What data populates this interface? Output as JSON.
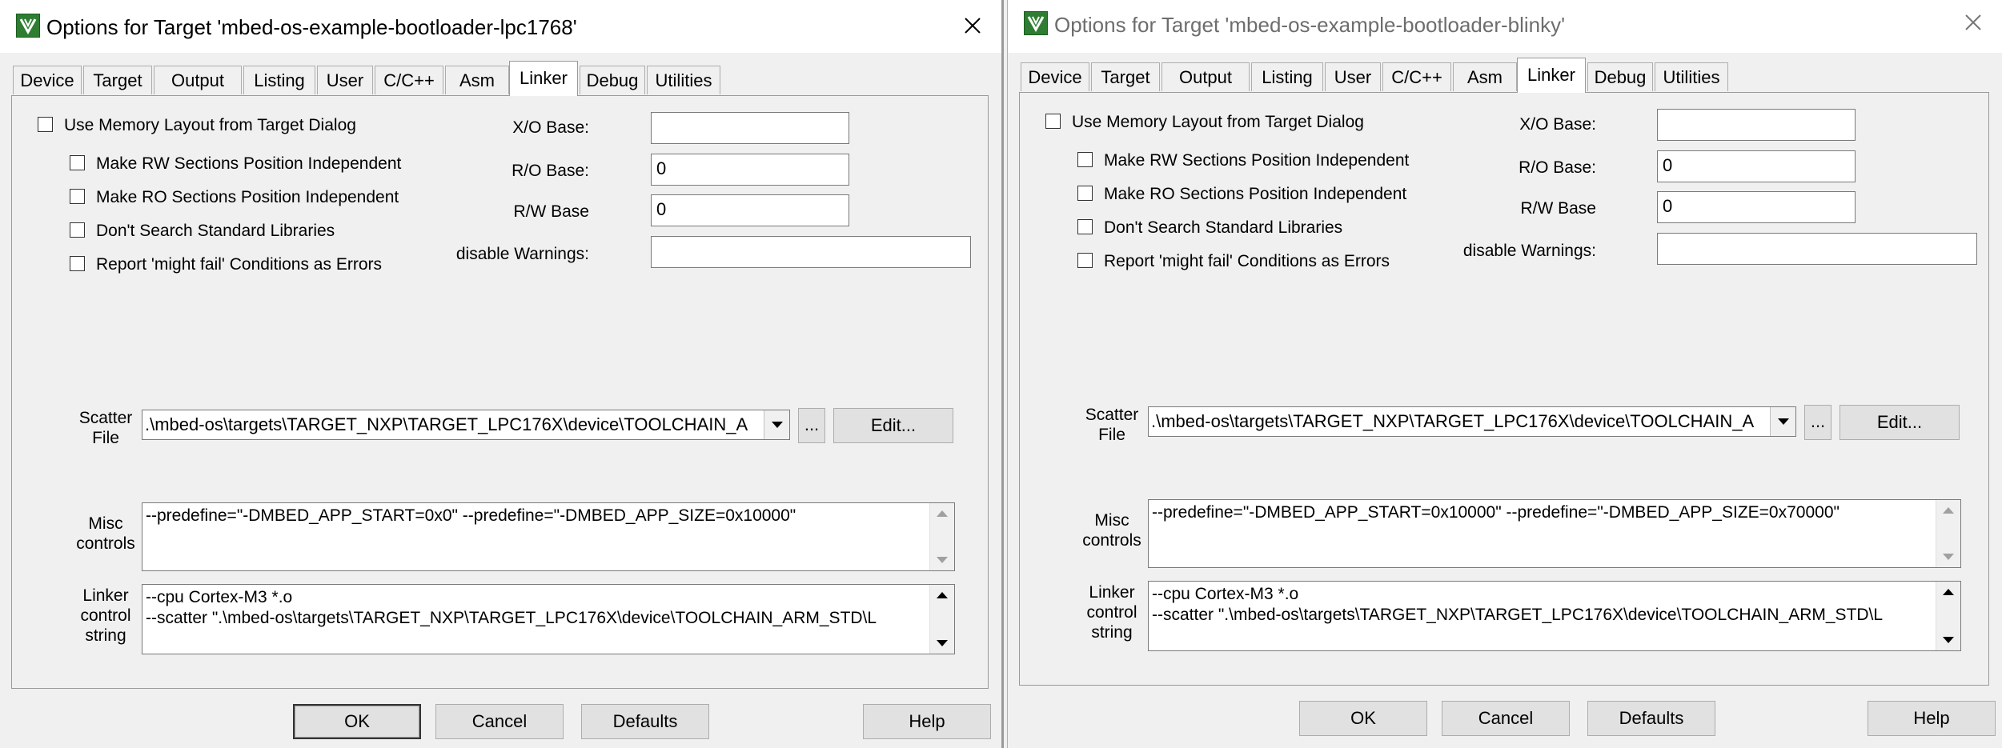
{
  "tab_labels": [
    "Device",
    "Target",
    "Output",
    "Listing",
    "User",
    "C/C++",
    "Asm",
    "Linker",
    "Debug",
    "Utilities"
  ],
  "common": {
    "checkboxes": {
      "use_memory_layout": "Use Memory Layout from Target Dialog",
      "rw_independent": "Make RW Sections Position Independent",
      "ro_independent": "Make RO Sections Position Independent",
      "dont_search_std": "Don't Search Standard Libraries",
      "report_might_fail": "Report 'might fail' Conditions as Errors"
    },
    "labels": {
      "xo_base": "X/O Base:",
      "ro_base": "R/O Base:",
      "rw_base": "R/W Base",
      "disable_warnings": "disable Warnings:",
      "scatter": "Scatter",
      "file": "File",
      "misc": "Misc",
      "controls": "controls",
      "linker": "Linker",
      "control": "control",
      "string": "string"
    },
    "buttons": {
      "browse": "...",
      "edit": "Edit...",
      "ok": "OK",
      "cancel": "Cancel",
      "defaults": "Defaults",
      "help": "Help"
    },
    "icons": {
      "app": "keil-uvision-icon",
      "close": "close-icon",
      "dropdown": "dropdown-arrow-icon",
      "scroll_up": "scroll-up-arrow-icon",
      "scroll_down": "scroll-down-arrow-icon"
    }
  },
  "left": {
    "title": "Options for Target 'mbed-os-example-bootloader-lpc1768'",
    "active_tab": "Linker",
    "checkboxes_checked": [
      false,
      false,
      false,
      false,
      false
    ],
    "fields": {
      "xo_base": "",
      "ro_base": "0",
      "rw_base": "0",
      "disable_warnings": ""
    },
    "scatter_file": ".\\mbed-os\\targets\\TARGET_NXP\\TARGET_LPC176X\\device\\TOOLCHAIN_A",
    "misc_controls": "--predefine=\"-DMBED_APP_START=0x0\" --predefine=\"-DMBED_APP_SIZE=0x10000\"",
    "linker_control_string": "--cpu Cortex-M3 *.o\n--scatter \".\\mbed-os\\targets\\TARGET_NXP\\TARGET_LPC176X\\device\\TOOLCHAIN_ARM_STD\\L"
  },
  "right": {
    "title": "Options for Target 'mbed-os-example-bootloader-blinky'",
    "active_tab": "Linker",
    "checkboxes_checked": [
      false,
      false,
      false,
      false,
      false
    ],
    "fields": {
      "xo_base": "",
      "ro_base": "0",
      "rw_base": "0",
      "disable_warnings": ""
    },
    "scatter_file": ".\\mbed-os\\targets\\TARGET_NXP\\TARGET_LPC176X\\device\\TOOLCHAIN_A",
    "misc_controls": "--predefine=\"-DMBED_APP_START=0x10000\" --predefine=\"-DMBED_APP_SIZE=0x70000\"",
    "linker_control_string": "--cpu Cortex-M3 *.o\n--scatter \".\\mbed-os\\targets\\TARGET_NXP\\TARGET_LPC176X\\device\\TOOLCHAIN_ARM_STD\\L"
  }
}
